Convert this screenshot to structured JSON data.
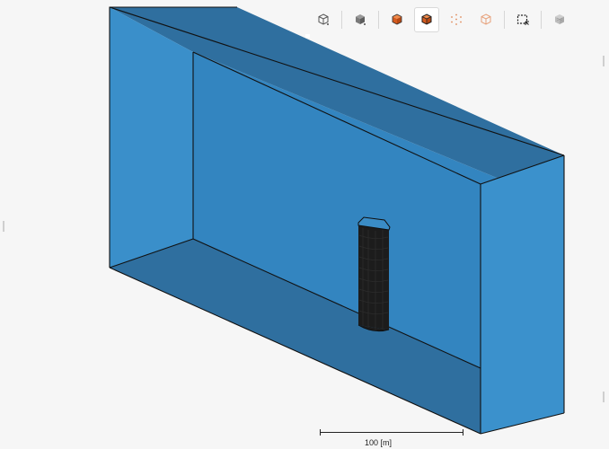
{
  "toolbar": {
    "buttons": [
      {
        "icon": "cube-outline-icon",
        "state": "normal"
      },
      {
        "icon": "cube-solid-icon",
        "state": "normal"
      },
      {
        "icon": "cube-orange-solid-icon",
        "state": "normal"
      },
      {
        "icon": "cube-orange-highlight-icon",
        "state": "active"
      },
      {
        "icon": "cube-points-icon",
        "state": "normal"
      },
      {
        "icon": "cube-orange-outline-icon",
        "state": "normal"
      },
      {
        "icon": "box-select-icon",
        "state": "normal"
      },
      {
        "icon": "cube-disabled-icon",
        "state": "disabled"
      }
    ]
  },
  "scale_bar": {
    "label": "100 [m]"
  },
  "colors": {
    "background": "#f6f6f6",
    "domain_front": "#368ec8",
    "domain_shaded": "#2f6f9f",
    "domain_side": "#3c93cd",
    "building_dark": "#1b1b1b",
    "accent_orange": "#e0672a"
  }
}
